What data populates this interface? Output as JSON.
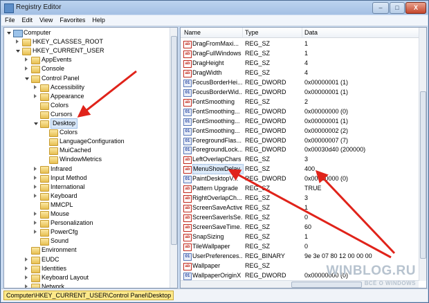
{
  "window": {
    "title": "Registry Editor",
    "controls": [
      "–",
      "□",
      "X"
    ]
  },
  "menu": [
    "File",
    "Edit",
    "View",
    "Favorites",
    "Help"
  ],
  "tree": [
    {
      "label": "Computer",
      "icon": "computer-icon"
    },
    {
      "label": "HKEY_CLASSES_ROOT"
    },
    {
      "label": "HKEY_CURRENT_USER"
    },
    {
      "label": "AppEvents"
    },
    {
      "label": "Console"
    },
    {
      "label": "Control Panel"
    },
    {
      "label": "Accessibility"
    },
    {
      "label": "Appearance"
    },
    {
      "label": "Colors"
    },
    {
      "label": "Cursors"
    },
    {
      "label": "Desktop",
      "selected": true
    },
    {
      "label": "Colors"
    },
    {
      "label": "LanguageConfiguration"
    },
    {
      "label": "MuiCached"
    },
    {
      "label": "WindowMetrics"
    },
    {
      "label": "Infrared"
    },
    {
      "label": "Input Method"
    },
    {
      "label": "International"
    },
    {
      "label": "Keyboard"
    },
    {
      "label": "MMCPL"
    },
    {
      "label": "Mouse"
    },
    {
      "label": "Personalization"
    },
    {
      "label": "PowerCfg"
    },
    {
      "label": "Sound"
    },
    {
      "label": "Environment"
    },
    {
      "label": "EUDC"
    },
    {
      "label": "Identities"
    },
    {
      "label": "Keyboard Layout"
    },
    {
      "label": "Network"
    }
  ],
  "list": {
    "headers": [
      "Name",
      "Type",
      "Data"
    ],
    "rows": [
      {
        "name": "DragFromMaxi...",
        "type": "REG_SZ",
        "data": "1",
        "icon": "ab"
      },
      {
        "name": "DragFullWindows",
        "type": "REG_SZ",
        "data": "1",
        "icon": "ab"
      },
      {
        "name": "DragHeight",
        "type": "REG_SZ",
        "data": "4",
        "icon": "ab"
      },
      {
        "name": "DragWidth",
        "type": "REG_SZ",
        "data": "4",
        "icon": "ab"
      },
      {
        "name": "FocusBorderHei...",
        "type": "REG_DWORD",
        "data": "0x00000001 (1)",
        "icon": "bin"
      },
      {
        "name": "FocusBorderWid...",
        "type": "REG_DWORD",
        "data": "0x00000001 (1)",
        "icon": "bin"
      },
      {
        "name": "FontSmoothing",
        "type": "REG_SZ",
        "data": "2",
        "icon": "ab"
      },
      {
        "name": "FontSmoothing...",
        "type": "REG_DWORD",
        "data": "0x00000000 (0)",
        "icon": "bin"
      },
      {
        "name": "FontSmoothing...",
        "type": "REG_DWORD",
        "data": "0x00000001 (1)",
        "icon": "bin"
      },
      {
        "name": "FontSmoothing...",
        "type": "REG_DWORD",
        "data": "0x00000002 (2)",
        "icon": "bin"
      },
      {
        "name": "ForegroundFlas...",
        "type": "REG_DWORD",
        "data": "0x00000007 (7)",
        "icon": "bin"
      },
      {
        "name": "ForegroundLock...",
        "type": "REG_DWORD",
        "data": "0x00030d40 (200000)",
        "icon": "bin"
      },
      {
        "name": "LeftOverlapChars",
        "type": "REG_SZ",
        "data": "3",
        "icon": "ab"
      },
      {
        "name": "MenuShowDelay",
        "type": "REG_SZ",
        "data": "400",
        "icon": "ab",
        "selected": true
      },
      {
        "name": "PaintDesktopV...",
        "type": "REG_DWORD",
        "data": "0x00000000 (0)",
        "icon": "bin"
      },
      {
        "name": "Pattern Upgrade",
        "type": "REG_SZ",
        "data": "TRUE",
        "icon": "ab"
      },
      {
        "name": "RightOverlapCh...",
        "type": "REG_SZ",
        "data": "3",
        "icon": "ab"
      },
      {
        "name": "ScreenSaveActive",
        "type": "REG_SZ",
        "data": "1",
        "icon": "ab"
      },
      {
        "name": "ScreenSaverIsSe...",
        "type": "REG_SZ",
        "data": "0",
        "icon": "ab"
      },
      {
        "name": "ScreenSaveTime...",
        "type": "REG_SZ",
        "data": "60",
        "icon": "ab"
      },
      {
        "name": "SnapSizing",
        "type": "REG_SZ",
        "data": "1",
        "icon": "ab"
      },
      {
        "name": "TileWallpaper",
        "type": "REG_SZ",
        "data": "0",
        "icon": "ab"
      },
      {
        "name": "UserPreferences...",
        "type": "REG_BINARY",
        "data": "9e 3e 07 80 12 00 00 00",
        "icon": "bin"
      },
      {
        "name": "Wallpaper",
        "type": "REG_SZ",
        "data": "",
        "icon": "ab"
      },
      {
        "name": "WallpaperOriginX",
        "type": "REG_DWORD",
        "data": "0x00000000 (0)",
        "icon": "bin"
      }
    ]
  },
  "status": {
    "path": "Computer\\HKEY_CURRENT_USER\\Control Panel\\Desktop"
  },
  "watermark": {
    "line1": "WINBLOG.RU",
    "line2": "ВСЁ О WINDOWS"
  },
  "colors": {
    "arrow": "#e0231a",
    "selection": "#d9e8f9",
    "status_highlight": "#fde98a"
  }
}
